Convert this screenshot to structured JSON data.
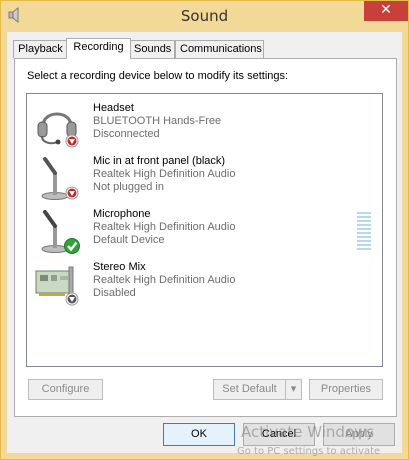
{
  "window": {
    "title": "Sound",
    "close_label": "✕"
  },
  "tabs": [
    {
      "label": "Playback"
    },
    {
      "label": "Recording"
    },
    {
      "label": "Sounds"
    },
    {
      "label": "Communications"
    }
  ],
  "active_tab": "Recording",
  "instruction": "Select a recording device below to modify its settings:",
  "devices": [
    {
      "name": "Headset",
      "driver": "BLUETOOTH Hands-Free",
      "status": "Disconnected",
      "icon": "headset-icon",
      "badge": "disconnected-badge"
    },
    {
      "name": "Mic in at front panel (black)",
      "driver": "Realtek High Definition Audio",
      "status": "Not plugged in",
      "icon": "microphone-icon",
      "badge": "unplugged-badge"
    },
    {
      "name": "Microphone",
      "driver": "Realtek High Definition Audio",
      "status": "Default Device",
      "icon": "microphone-icon",
      "badge": "default-check-badge"
    },
    {
      "name": "Stereo Mix",
      "driver": "Realtek High Definition Audio",
      "status": "Disabled",
      "icon": "sound-card-icon",
      "badge": "disabled-badge"
    }
  ],
  "buttons": {
    "configure": "Configure",
    "set_default": "Set Default",
    "properties": "Properties",
    "ok": "OK",
    "cancel": "Cancel",
    "apply": "Apply"
  },
  "watermark": {
    "line1": "Activate Windows",
    "line2": "Go to PC settings to activate"
  },
  "colors": {
    "title_bar": "#f3d998",
    "close_button": "#c7413a",
    "default_check": "#2fa33a",
    "status_red": "#c62828"
  }
}
